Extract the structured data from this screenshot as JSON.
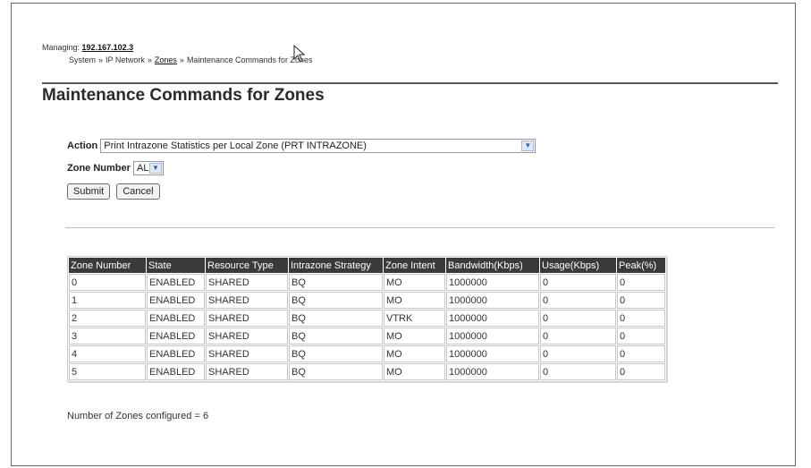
{
  "header": {
    "managing_label": "Managing:",
    "managing_ip": "192.167.102.3",
    "breadcrumb": [
      "System",
      "IP Network",
      "Zones",
      "Maintenance Commands for Zones"
    ],
    "breadcrumb_sep": "»"
  },
  "page": {
    "title": "Maintenance Commands for Zones"
  },
  "form": {
    "action_label": "Action",
    "action_value": "Print Intrazone Statistics per Local Zone (PRT INTRAZONE)",
    "zone_label": "Zone Number",
    "zone_value": "ALL",
    "submit_label": "Submit",
    "cancel_label": "Cancel"
  },
  "table": {
    "columns": [
      "Zone Number",
      "State",
      "Resource Type",
      "Intrazone Strategy",
      "Zone Intent",
      "Bandwidth(Kbps)",
      "Usage(Kbps)",
      "Peak(%)"
    ],
    "rows": [
      [
        "0",
        "ENABLED",
        "SHARED",
        "BQ",
        "MO",
        "1000000",
        "0",
        "0"
      ],
      [
        "1",
        "ENABLED",
        "SHARED",
        "BQ",
        "MO",
        "1000000",
        "0",
        "0"
      ],
      [
        "2",
        "ENABLED",
        "SHARED",
        "BQ",
        "VTRK",
        "1000000",
        "0",
        "0"
      ],
      [
        "3",
        "ENABLED",
        "SHARED",
        "BQ",
        "MO",
        "1000000",
        "0",
        "0"
      ],
      [
        "4",
        "ENABLED",
        "SHARED",
        "BQ",
        "MO",
        "1000000",
        "0",
        "0"
      ],
      [
        "5",
        "ENABLED",
        "SHARED",
        "BQ",
        "MO",
        "1000000",
        "0",
        "0"
      ]
    ]
  },
  "summary": {
    "text": "Number of Zones configured = 6"
  },
  "icons": {
    "cursor": "mouse-pointer-icon",
    "dropdown": "chevron-down-icon"
  }
}
